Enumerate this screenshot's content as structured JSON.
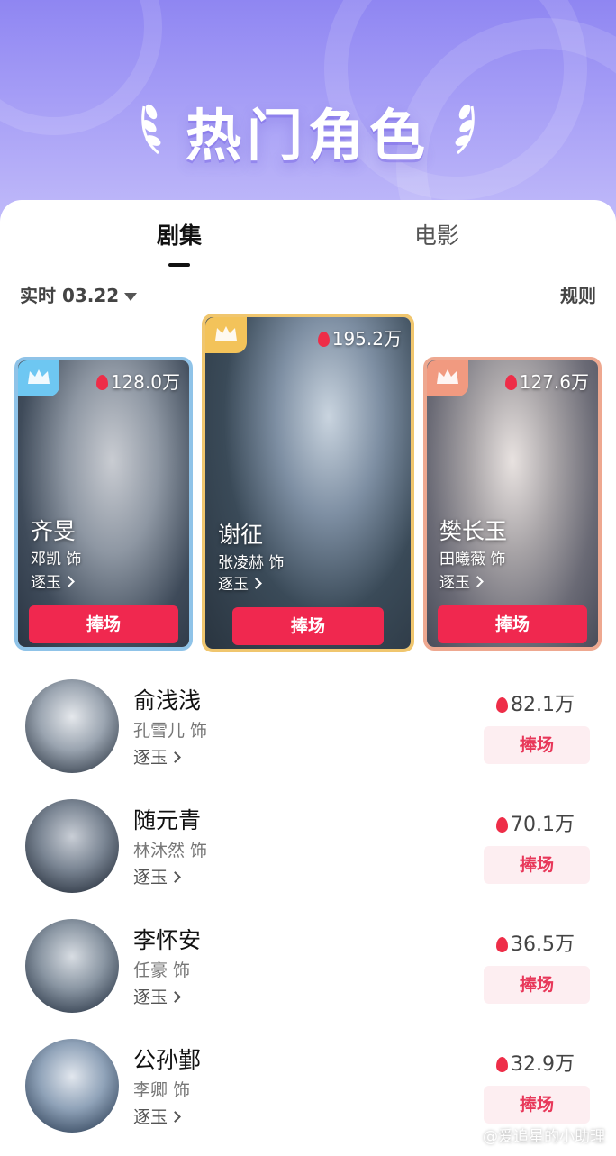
{
  "banner": {
    "title": "热门角色"
  },
  "tabs": [
    {
      "label": "剧集",
      "active": true
    },
    {
      "label": "电影",
      "active": false
    }
  ],
  "filter": {
    "date": "实时 03.22",
    "rules": "规则"
  },
  "top3": [
    {
      "rank": 2,
      "heat": "128.0万",
      "name": "齐旻",
      "actor": "邓凯 饰",
      "show": "逐玉",
      "button": "捧场",
      "crown_color": "#6ec7f2",
      "border_color": "#8fc3e8"
    },
    {
      "rank": 1,
      "heat": "195.2万",
      "name": "谢征",
      "actor": "张凌赫 饰",
      "show": "逐玉",
      "button": "捧场",
      "crown_color": "#f3c35a",
      "border_color": "#f0c66e"
    },
    {
      "rank": 3,
      "heat": "127.6万",
      "name": "樊长玉",
      "actor": "田曦薇 饰",
      "show": "逐玉",
      "button": "捧场",
      "crown_color": "#f19a80",
      "border_color": "#eea890"
    }
  ],
  "list": [
    {
      "name": "俞浅浅",
      "actor": "孔雪儿 饰",
      "show": "逐玉",
      "heat": "82.1万",
      "button": "捧场"
    },
    {
      "name": "随元青",
      "actor": "林沐然 饰",
      "show": "逐玉",
      "heat": "70.1万",
      "button": "捧场"
    },
    {
      "name": "李怀安",
      "actor": "任豪 饰",
      "show": "逐玉",
      "heat": "36.5万",
      "button": "捧场"
    },
    {
      "name": "公孙鄞",
      "actor": "李卿 饰",
      "show": "逐玉",
      "heat": "32.9万",
      "button": "捧场"
    }
  ],
  "watermark": "@爱追星的小助理"
}
